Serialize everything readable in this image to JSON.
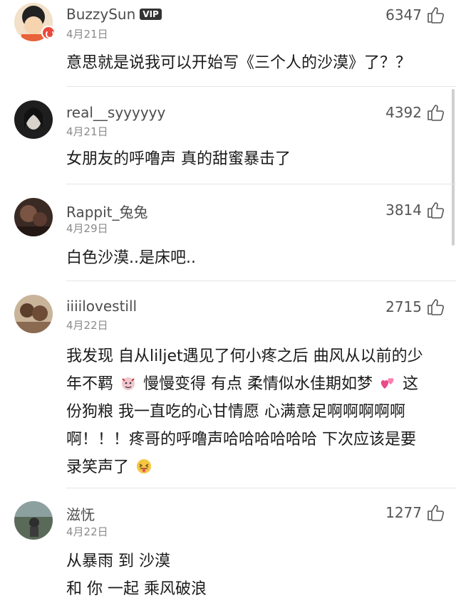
{
  "comments": [
    {
      "username": "BuzzySun",
      "vip": "VIP",
      "date": "4月21日",
      "likes": "6347",
      "lines": [
        "意思就是说我可以开始写《三个人的沙漠》了？？"
      ]
    },
    {
      "username": "real__syyyyyy",
      "date": "4月21日",
      "likes": "4392",
      "lines": [
        "女朋友的呼噜声 真的甜蜜暴击了"
      ]
    },
    {
      "username": "Rappit_兔兔",
      "date": "4月29日",
      "likes": "3814",
      "lines": [
        "白色沙漠..是床吧.."
      ]
    },
    {
      "username": "iiiilovestill",
      "date": "4月22日",
      "likes": "2715",
      "lines": [
        "我发现 自从liljet遇见了何小疼之后 曲风从以前的少",
        "年不羁",
        "慢慢变得 有点 柔情似水佳期如梦",
        "这",
        "份狗粮 我一直吃的心甘情愿 心满意足啊啊啊啊啊",
        "啊！！！疼哥的呼噜声哈哈哈哈哈哈 下次应该是要",
        "录笑声了"
      ]
    },
    {
      "username": "滋怃",
      "date": "4月22日",
      "likes": "1277",
      "lines": [
        "从暴雨 到 沙漠",
        "和 你 一起 乘风破浪"
      ]
    }
  ],
  "icons": {
    "like": "thumbs-up-icon",
    "verified": "verified-badge-icon",
    "devil": "devil-emoji-icon",
    "hearts": "two-hearts-emoji-icon",
    "tongue": "tongue-out-emoji-icon"
  },
  "colors": {
    "vip_bg": "#333333",
    "badge": "#e8483b"
  }
}
